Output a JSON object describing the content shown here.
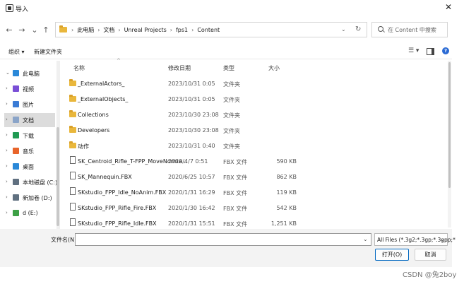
{
  "window": {
    "title": "导入",
    "close_label": "✕"
  },
  "nav": {
    "back": "←",
    "forward": "→",
    "dropdown": "⌄",
    "up": "↑",
    "breadcrumb": [
      "此电脑",
      "文档",
      "Unreal Projects",
      "fps1",
      "Content"
    ],
    "separator": "›",
    "search_placeholder": "在 Content 中搜索"
  },
  "toolbar": {
    "organize": "组织 ▾",
    "new_folder": "新建文件夹",
    "view_menu": "☰ ▾"
  },
  "sidebar": {
    "items": [
      {
        "label": "此电脑",
        "expanded": true,
        "icon": "computer-icon",
        "color": "#2a88d8"
      },
      {
        "label": "视频",
        "icon": "video-icon",
        "color": "#7a4fd6"
      },
      {
        "label": "图片",
        "icon": "pictures-icon",
        "color": "#3a7bd5"
      },
      {
        "label": "文档",
        "icon": "documents-icon",
        "color": "#8aa4c8",
        "selected": true
      },
      {
        "label": "下载",
        "icon": "download-icon",
        "color": "#1f9a52"
      },
      {
        "label": "音乐",
        "icon": "music-icon",
        "color": "#e8642a"
      },
      {
        "label": "桌面",
        "icon": "desktop-icon",
        "color": "#2a88d8"
      },
      {
        "label": "本地磁盘 (C:)",
        "icon": "drive-icon",
        "color": "#607080"
      },
      {
        "label": "新加卷 (D:)",
        "icon": "drive-icon",
        "color": "#607080"
      },
      {
        "label": "d (E:)",
        "icon": "usb-drive-icon",
        "color": "#3da045"
      }
    ]
  },
  "columns": {
    "name": "名称",
    "date": "修改日期",
    "type": "类型",
    "size": "大小"
  },
  "files": [
    {
      "name": "_ExternalActors_",
      "date": "2023/10/31 0:05",
      "type": "文件夹",
      "size": "",
      "kind": "folder"
    },
    {
      "name": "_ExternalObjects_",
      "date": "2023/10/31 0:05",
      "type": "文件夹",
      "size": "",
      "kind": "folder"
    },
    {
      "name": "Collections",
      "date": "2023/10/30 23:08",
      "type": "文件夹",
      "size": "",
      "kind": "folder"
    },
    {
      "name": "Developers",
      "date": "2023/10/30 23:08",
      "type": "文件夹",
      "size": "",
      "kind": "folder"
    },
    {
      "name": "动作",
      "date": "2023/10/31 0:40",
      "type": "文件夹",
      "size": "",
      "kind": "folder"
    },
    {
      "name": "SK_Centroid_Rifle_T-FPP_MoveNorma...",
      "date": "2020/4/7 0:51",
      "type": "FBX 文件",
      "size": "590 KB",
      "kind": "file"
    },
    {
      "name": "SK_Mannequin.FBX",
      "date": "2020/6/25 10:57",
      "type": "FBX 文件",
      "size": "862 KB",
      "kind": "file"
    },
    {
      "name": "SKstudio_FPP_Idle_NoAnim.FBX",
      "date": "2020/1/31 16:29",
      "type": "FBX 文件",
      "size": "119 KB",
      "kind": "file"
    },
    {
      "name": "SKstudio_FPP_Rifle_Fire.FBX",
      "date": "2020/1/30 16:42",
      "type": "FBX 文件",
      "size": "542 KB",
      "kind": "file"
    },
    {
      "name": "SKstudio_FPP_Rifle_Idle.FBX",
      "date": "2020/1/31 15:51",
      "type": "FBX 文件",
      "size": "1,251 KB",
      "kind": "file"
    }
  ],
  "footer": {
    "filename_label": "文件名(N):",
    "filename_value": "",
    "filetype_value": "All Files (*.3g2;*.3gp;*.3gpp;*",
    "open_label": "打开(O)",
    "cancel_label": "取消"
  },
  "watermark": "CSDN @兔2boy"
}
